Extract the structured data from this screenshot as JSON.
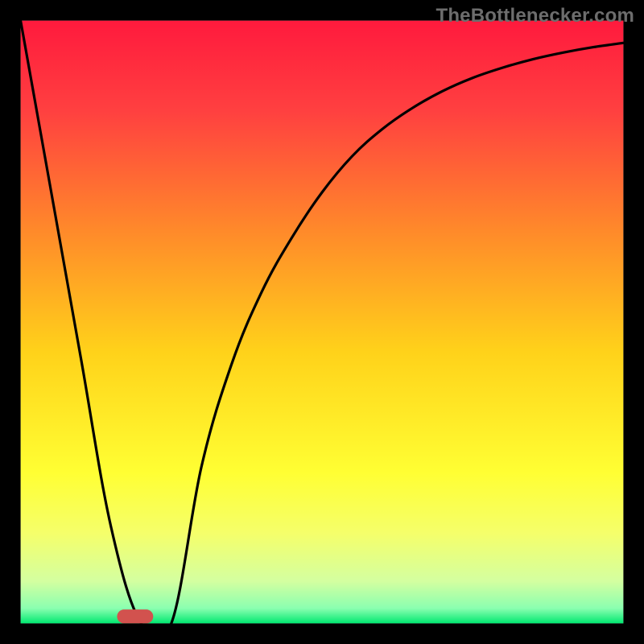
{
  "chart_data": {
    "type": "line",
    "title": "",
    "xlabel": "",
    "ylabel": "",
    "xlim": [
      0,
      100
    ],
    "ylim": [
      0,
      100
    ],
    "grid": false,
    "series": [
      {
        "name": "curve",
        "x": [
          0,
          5,
          10,
          15,
          20,
          25,
          30,
          35,
          40,
          45,
          50,
          55,
          60,
          65,
          70,
          75,
          80,
          85,
          90,
          95,
          100
        ],
        "values": [
          100,
          72,
          44,
          16,
          0,
          0,
          26,
          43,
          55,
          64,
          71.5,
          77.5,
          82,
          85.5,
          88.3,
          90.5,
          92.2,
          93.6,
          94.7,
          95.6,
          96.3
        ]
      }
    ],
    "sweet_spot": {
      "x": 19,
      "width": 6,
      "height": 2.3
    },
    "gradient_stops": [
      {
        "offset": 0.0,
        "color": "#ff1a3d"
      },
      {
        "offset": 0.15,
        "color": "#ff4040"
      },
      {
        "offset": 0.35,
        "color": "#ff8a2a"
      },
      {
        "offset": 0.55,
        "color": "#ffd21a"
      },
      {
        "offset": 0.75,
        "color": "#ffff33"
      },
      {
        "offset": 0.85,
        "color": "#f5ff6a"
      },
      {
        "offset": 0.93,
        "color": "#d4ffa0"
      },
      {
        "offset": 0.975,
        "color": "#8affb0"
      },
      {
        "offset": 1.0,
        "color": "#00e870"
      }
    ],
    "frame_thickness": 3.2
  },
  "colors": {
    "frame": "#000000",
    "curve": "#000000",
    "sweet_spot": "#d2524e"
  },
  "watermark": "TheBottlenecker.com"
}
